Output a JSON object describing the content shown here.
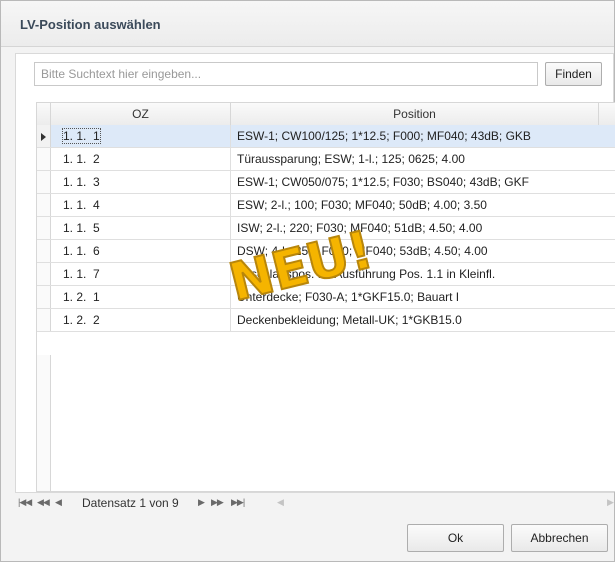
{
  "window": {
    "title": "LV-Position auswählen"
  },
  "search": {
    "placeholder": "Bitte Suchtext hier eingeben...",
    "value": "",
    "find_label": "Finden"
  },
  "table": {
    "columns": [
      "OZ",
      "Position"
    ],
    "rows": [
      {
        "oz": "1. 1.  1",
        "position": "ESW-1; CW100/125; 1*12.5; F000; MF040; 43dB; GKB",
        "selected": true
      },
      {
        "oz": "1. 1.  2",
        "position": "Türaussparung; ESW; 1-l.; 125; 0625; 4.00",
        "selected": false
      },
      {
        "oz": "1. 1.  3",
        "position": "ESW-1; CW050/075; 1*12.5; F030; BS040; 43dB; GKF",
        "selected": false
      },
      {
        "oz": "1. 1.  4",
        "position": "ESW; 2-l.; 100; F030; MF040; 50dB; 4.00; 3.50",
        "selected": false
      },
      {
        "oz": "1. 1.  5",
        "position": "ISW; 2-l.; 220; F030; MF040; 51dB; 4.50; 4.00",
        "selected": false
      },
      {
        "oz": "1. 1.  6",
        "position": "DSW; 4-l.; 255; F030; MF040; 53dB; 4.50; 4.00",
        "selected": false
      },
      {
        "oz": "1. 1.  7",
        "position": "Zuschlagspos. für Ausführung Pos. 1.1 in Kleinfl.",
        "selected": false
      },
      {
        "oz": "1. 2.  1",
        "position": "Unterdecke;  F030-A; 1*GKF15.0; Bauart I",
        "selected": false
      },
      {
        "oz": "1. 2.  2",
        "position": "Deckenbekleidung; Metall-UK; 1*GKB15.0",
        "selected": false
      }
    ]
  },
  "navigator": {
    "first_icon": "first-record-icon",
    "prev_page_icon": "previous-page-icon",
    "prev_icon": "previous-record-icon",
    "record_text": "Datensatz 1 von 9",
    "next_icon": "next-record-icon",
    "next_page_icon": "next-page-icon",
    "last_icon": "last-record-icon"
  },
  "buttons": {
    "ok": "Ok",
    "cancel": "Abbrechen"
  },
  "overlay": {
    "stamp_text": "NEU!",
    "stamp_color": "#f5b400",
    "stamp_outline": "#b8860b"
  },
  "colors": {
    "selected_row": "#dde9f8",
    "title_text": "#3b4a5a"
  }
}
